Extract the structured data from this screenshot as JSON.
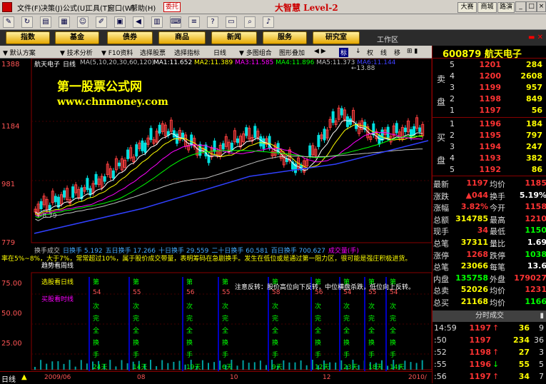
{
  "menu": {
    "items": [
      "文件(F)",
      "决策(J)",
      "公式(U)",
      "工具(T)",
      "窗口(W)",
      "帮助(H)"
    ],
    "wt": "委托",
    "logo": "大智慧 Level-2",
    "btns": [
      "大赛",
      "商城",
      "路演"
    ]
  },
  "nav": {
    "items": [
      "指数",
      "基金",
      "债券",
      "商品",
      "新闻",
      "服务",
      "研究室"
    ],
    "work": "工作区"
  },
  "tabs": [
    "默认方案",
    "技术分析",
    "F10资料",
    "选择股票",
    "选择指标",
    "日线",
    "多图组合",
    "图形叠加",
    "标",
    "↓",
    "权",
    "线",
    "移"
  ],
  "chart": {
    "title": "航天电子",
    "period": "日线",
    "ma_label": "MA(5,10,20,30,60,120)",
    "ma": [
      {
        "name": "MA1:",
        "val": "11.652",
        "color": "#ffffff"
      },
      {
        "name": "MA2:",
        "val": "11.389",
        "color": "#ffff00"
      },
      {
        "name": "MA3:",
        "val": "11.585",
        "color": "#ff00ff"
      },
      {
        "name": "MA4:",
        "val": "11.896",
        "color": "#00ff00"
      },
      {
        "name": "MA5:",
        "val": "11.373",
        "color": "#c0c0c0"
      },
      {
        "name": "MA6:",
        "val": "11.144",
        "color": "#4040ff"
      }
    ],
    "watermark1": "第一股票公式网",
    "watermark2": "www.chnmoney.com",
    "hi": "13.88",
    "lo": "8.79",
    "yaxis": [
      "1388",
      "1184",
      "981",
      "779"
    ],
    "sub_y": [
      "75.00",
      "50.00",
      "25.00"
    ],
    "ind_name": "换手成交",
    "ind": [
      {
        "l": "日换手",
        "v": "5.192"
      },
      {
        "l": "五日换手",
        "v": "17.266"
      },
      {
        "l": "十日换手",
        "v": "29.559"
      },
      {
        "l": "二十日换手",
        "v": "60.581"
      },
      {
        "l": "百日换手",
        "v": "700.627"
      },
      {
        "l": "成交量(手)",
        "v": ""
      }
    ],
    "note": "率在5%~8%，大于7%，常常超过10%，属于股价成交带量，表明筹码在急剧换手。发生在低位或是通过第一阻力区，很可能是强庄积极进货。",
    "note2": "趋势看周线",
    "sel1": "选股看日线",
    "sel2": "买股看时线",
    "cols": [
      {
        "p": "第",
        "d": "54",
        "w": "24天"
      },
      {
        "p": "第",
        "d": "55",
        "w": "14天"
      },
      {
        "p": "第",
        "d": "56",
        "w": "19天"
      },
      {
        "p": "第",
        "d": "55",
        "w": "6天"
      },
      {
        "p": "第",
        "d": "58",
        "w": "9天"
      },
      {
        "p": "第",
        "d": "56",
        "w": "12天"
      },
      {
        "p": "第",
        "d": "54",
        "w": "23天"
      },
      {
        "p": "第",
        "d": "55",
        "w": "18天"
      },
      {
        "p": "第",
        "d": "54",
        "w": "14天"
      }
    ],
    "col_chars": [
      "次",
      "完",
      "全",
      "换",
      "手"
    ],
    "warn": "注意反转：股价高位向下反转，中位横盘杀跌，低位向上反转。",
    "bottom_label": "日线",
    "dates": [
      "2009/06",
      "08",
      "10",
      "12",
      "2010/"
    ]
  },
  "right": {
    "code": "600879",
    "name": "航天电子",
    "sell": [
      {
        "n": "5",
        "p": "1201",
        "q": "284"
      },
      {
        "n": "4",
        "p": "1200",
        "q": "2608"
      },
      {
        "n": "3",
        "p": "1199",
        "q": "957"
      },
      {
        "n": "2",
        "p": "1198",
        "q": "849"
      },
      {
        "n": "1",
        "p": "1197",
        "q": "56"
      }
    ],
    "buy": [
      {
        "n": "1",
        "p": "1196",
        "q": "184"
      },
      {
        "n": "2",
        "p": "1195",
        "q": "797"
      },
      {
        "n": "3",
        "p": "1194",
        "q": "247"
      },
      {
        "n": "4",
        "p": "1193",
        "q": "382"
      },
      {
        "n": "5",
        "p": "1192",
        "q": "86"
      }
    ],
    "sell_label": [
      "卖",
      "盘"
    ],
    "buy_label": [
      "买",
      "盘"
    ],
    "quotes": [
      {
        "l1": "最新",
        "v1": "1197",
        "c1": "r",
        "l2": "均价",
        "v2": "1185",
        "c2": "r"
      },
      {
        "l1": "涨跌",
        "v1": "▲044",
        "c1": "r",
        "l2": "换手",
        "v2": "5.19%",
        "c2": "w"
      },
      {
        "l1": "涨幅",
        "v1": "3.82%",
        "c1": "r",
        "l2": "今开",
        "v2": "1158",
        "c2": "r"
      },
      {
        "l1": "总额",
        "v1": "314785",
        "c1": "y",
        "l2": "最高",
        "v2": "1210",
        "c2": "r"
      },
      {
        "l1": "现手",
        "v1": "34",
        "c1": "r",
        "l2": "最低",
        "v2": "1150",
        "c2": "g"
      },
      {
        "l1": "总笔",
        "v1": "37311",
        "c1": "y",
        "l2": "量比",
        "v2": "1.69",
        "c2": "w"
      },
      {
        "l1": "涨停",
        "v1": "1268",
        "c1": "r",
        "l2": "跌停",
        "v2": "1038",
        "c2": "g"
      },
      {
        "l1": "总笔",
        "v1": "23066",
        "c1": "y",
        "l2": "每笔",
        "v2": "13.6",
        "c2": "w"
      },
      {
        "l1": "内盘",
        "v1": "135758",
        "c1": "g",
        "l2": "外盘",
        "v2": "179027",
        "c2": "r"
      },
      {
        "l1": "总卖",
        "v1": "52026",
        "c1": "y",
        "l2": "均价",
        "v2": "1231",
        "c2": "r"
      },
      {
        "l1": "总买",
        "v1": "21168",
        "c1": "y",
        "l2": "均价",
        "v2": "1166",
        "c2": "g"
      }
    ],
    "tick_title": "分时成交",
    "ticks": [
      {
        "t": "14:59",
        "p": "1197",
        "a": "↑",
        "q": "36",
        "c": "9",
        "pc": "r",
        "ac": "r"
      },
      {
        "t": ":50",
        "p": "1197",
        "a": "",
        "q": "234",
        "c": "36",
        "pc": "r",
        "ac": "r"
      },
      {
        "t": ":52",
        "p": "1198",
        "a": "↑",
        "q": "27",
        "c": "3",
        "pc": "r",
        "ac": "r"
      },
      {
        "t": ":55",
        "p": "1196",
        "a": "↓",
        "q": "55",
        "c": "5",
        "pc": "r",
        "ac": "g"
      },
      {
        "t": ":56",
        "p": "1197",
        "a": "↑",
        "q": "34",
        "c": "7",
        "pc": "r",
        "ac": "r"
      }
    ]
  }
}
